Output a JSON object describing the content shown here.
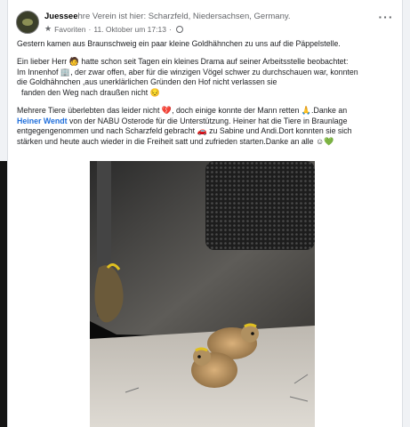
{
  "post": {
    "page_name_prefix": "Juessee",
    "page_name_rest": "hre Verein ist hier: Scharzfeld, Niedersachsen, Germany.",
    "favorites_label": "Favoriten",
    "date": "11. Oktober um 17:13",
    "more_label": "···",
    "paragraphs": {
      "p1": "Gestern kamen aus Braunschweig ein paar kleine Goldhähnchen zu uns auf die Päppelstelle.",
      "p2_a": "Ein lieber Herr",
      "p2_b": "hatte schon seit Tagen ein kleines Drama auf seiner Arbeitsstelle beobachtet:",
      "p2_c": "Im Innenhof",
      "p2_d": ", der zwar offen, aber für die winzigen Vögel schwer zu durchschauen war, konnten",
      "p2_e": "die Goldhähnchen ,aus unerklärlichen Gründen den Hof nicht verlassen sie",
      "p2_f": "fanden den Weg nach draußen nicht",
      "p3_a": "Mehrere Tiere überlebten das leider nicht",
      "p3_b": ", doch einige konnte der Mann retten",
      "p3_c": ".Danke an",
      "p3_link": "Heiner Wendt",
      "p3_d": "von der NABU Osterode für die Unterstützung. Heiner hat die Tiere in Braunlage",
      "p3_e": "entgegengenommen und nach Scharzfeld gebracht",
      "p3_f": "zu Sabine und Andi.Dort konnten sie sich",
      "p3_g": "stärken und heute auch wieder in die Freiheit satt und zufrieden starten.Danke an alle"
    },
    "emojis": {
      "man": "🧑",
      "house": "🏢",
      "sad": "😔",
      "broken_heart": "💔",
      "pray": "🙏",
      "car": "🚗",
      "smile": "☺",
      "green_heart": "💚"
    }
  },
  "colors": {
    "link": "#216fdb",
    "muted": "#65676b"
  }
}
